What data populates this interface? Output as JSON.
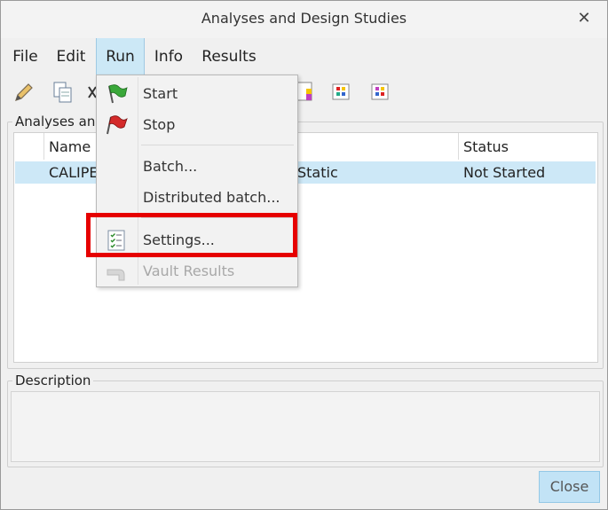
{
  "window": {
    "title": "Analyses and Design Studies"
  },
  "menubar": {
    "items": [
      "File",
      "Edit",
      "Run",
      "Info",
      "Results"
    ],
    "active": "Run"
  },
  "toolbar": {
    "buttons": [
      "pencil-icon",
      "copy-icon",
      "cut-icon",
      "report-icon",
      "view-results-icon",
      "compare-icon"
    ]
  },
  "analyses": {
    "group_label": "Analyses and",
    "columns": [
      "Name",
      "Status"
    ],
    "rows": [
      {
        "name": "CALIPE",
        "type": "Static",
        "status": "Not Started"
      }
    ]
  },
  "description": {
    "group_label": "Description",
    "text": ""
  },
  "buttons": {
    "close": "Close"
  },
  "run_menu": {
    "items": [
      {
        "label": "Start",
        "icon": "green-flag-icon",
        "enabled": true
      },
      {
        "label": "Stop",
        "icon": "red-flag-icon",
        "enabled": true
      },
      {
        "label": "Batch...",
        "icon": "",
        "enabled": true
      },
      {
        "label": "Distributed batch...",
        "icon": "",
        "enabled": true
      },
      {
        "label": "Settings...",
        "icon": "settings-list-icon",
        "enabled": true
      },
      {
        "label": "Vault Results",
        "icon": "vault-icon",
        "enabled": false
      }
    ]
  },
  "colors": {
    "selection": "#cde8f7",
    "highlight": "#e60000",
    "active_menu": "#cce8f6"
  }
}
